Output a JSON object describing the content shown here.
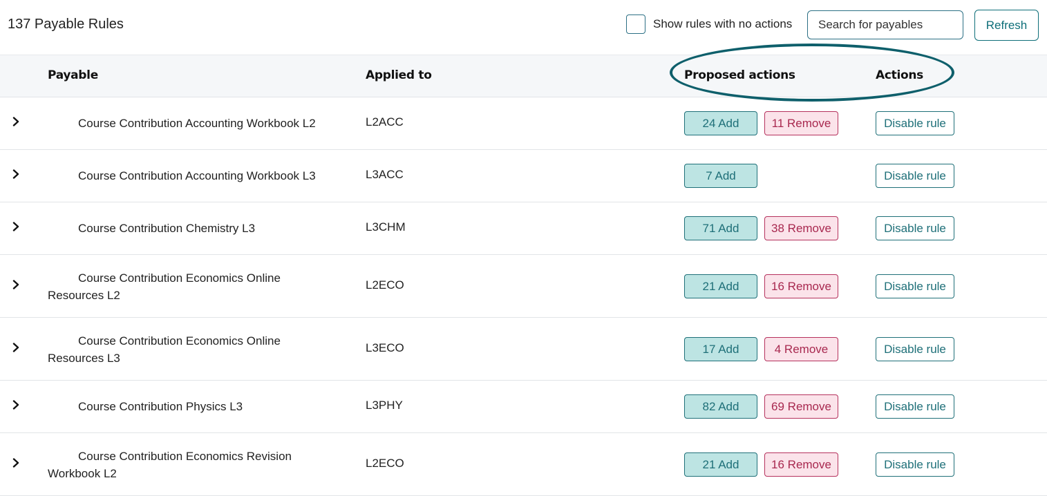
{
  "header": {
    "title": "137 Payable Rules",
    "show_no_actions_label": "Show rules with no actions",
    "search_placeholder": "Search for payables",
    "refresh_label": "Refresh"
  },
  "columns": {
    "payable": "Payable",
    "applied_to": "Applied to",
    "proposed_actions": "Proposed actions",
    "actions": "Actions"
  },
  "icons": {
    "expand": "chevron-right-icon"
  },
  "colors": {
    "accent": "#0d6e78",
    "add_bg": "#bde4e3",
    "remove_bg": "#fbe3ea",
    "remove_text": "#a8284f",
    "annotation": "#0e5f6b"
  },
  "rows": [
    {
      "payable": "Course Contribution Accounting Workbook L2",
      "applied_to": "L2ACC",
      "add": "24 Add",
      "remove": "11 Remove",
      "action": "Disable rule"
    },
    {
      "payable": "Course Contribution Accounting Workbook L3",
      "applied_to": "L3ACC",
      "add": "7 Add",
      "remove": null,
      "action": "Disable rule"
    },
    {
      "payable": "Course Contribution Chemistry L3",
      "applied_to": "L3CHM",
      "add": "71 Add",
      "remove": "38 Remove",
      "action": "Disable rule"
    },
    {
      "payable": "Course Contribution Economics Online Resources L2",
      "applied_to": "L2ECO",
      "add": "21 Add",
      "remove": "16 Remove",
      "action": "Disable rule"
    },
    {
      "payable": "Course Contribution Economics Online Resources L3",
      "applied_to": "L3ECO",
      "add": "17 Add",
      "remove": "4 Remove",
      "action": "Disable rule"
    },
    {
      "payable": "Course Contribution Physics L3",
      "applied_to": "L3PHY",
      "add": "82 Add",
      "remove": "69 Remove",
      "action": "Disable rule"
    },
    {
      "payable": "Course Contribution Economics Revision Workbook L2",
      "applied_to": "L2ECO",
      "add": "21 Add",
      "remove": "16 Remove",
      "action": "Disable rule"
    }
  ]
}
